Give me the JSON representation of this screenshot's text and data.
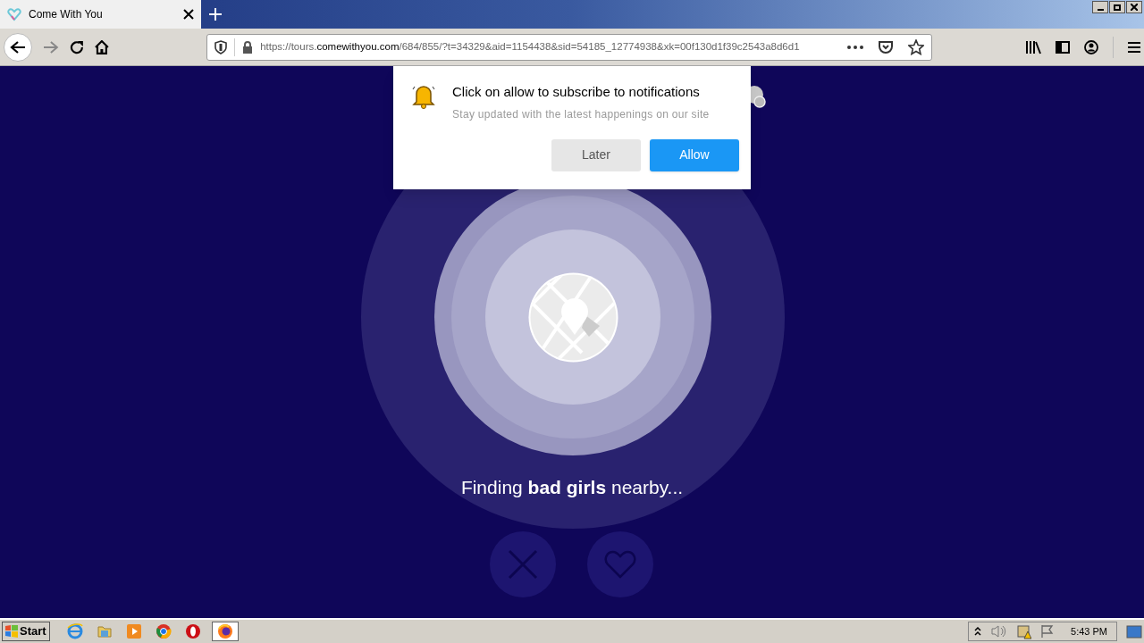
{
  "browser": {
    "tab": {
      "title": "Come With You",
      "selected": true
    },
    "url": {
      "prefix": "https://tours.",
      "domain": "comewithyou.com",
      "rest": "/684/855/?t=34329&aid=1154438&sid=54185_12774938&xk=00f130d1f39c2543a8d6d1"
    }
  },
  "notification": {
    "title": "Click on allow to subscribe to notifications",
    "subtitle": "Stay updated with the latest happenings on our site",
    "buttons": [
      {
        "label": "Later",
        "kind": "secondary"
      },
      {
        "label": "Allow",
        "kind": "primary"
      }
    ]
  },
  "page": {
    "status": "Finding **bad girls** nearby..."
  },
  "taskbar": {
    "start": "Start",
    "clock": "5:43 PM",
    "apps": [
      {
        "kind": "ie",
        "selected": false
      },
      {
        "kind": "folder",
        "selected": false
      },
      {
        "kind": "media",
        "selected": false
      },
      {
        "kind": "chrome",
        "selected": false
      },
      {
        "kind": "opera",
        "selected": false
      },
      {
        "kind": "firefox",
        "selected": true
      }
    ]
  }
}
